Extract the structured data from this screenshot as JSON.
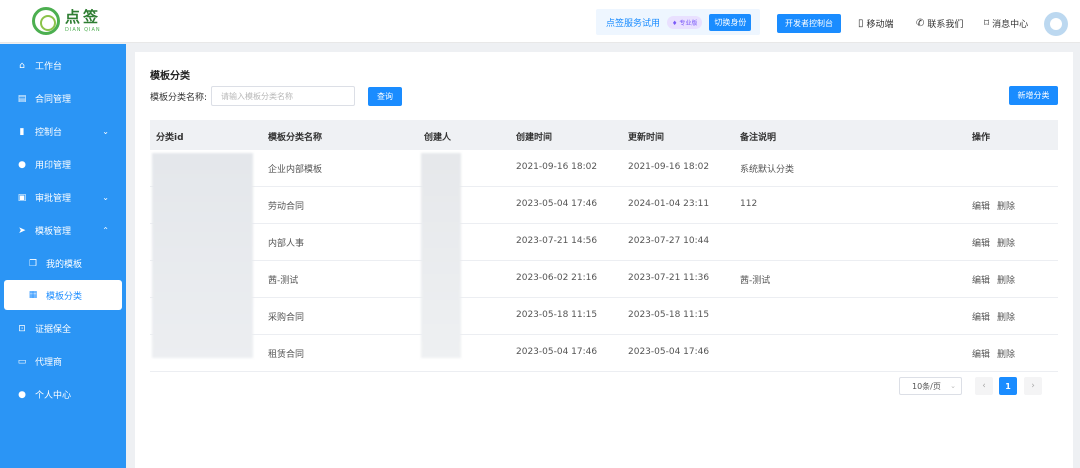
{
  "brand": {
    "name_cn": "点签",
    "name_en": "DIAN QIAN"
  },
  "header": {
    "trial_text": "点签服务试用",
    "pro_badge": "专业版",
    "switch_identity": "切换身份",
    "dev_console": "开发者控制台",
    "mobile": "移动端",
    "contact": "联系我们",
    "messages": "消息中心"
  },
  "sidebar": {
    "items": [
      {
        "label": "工作台",
        "icon": "home-icon"
      },
      {
        "label": "合同管理",
        "icon": "document-icon"
      },
      {
        "label": "控制台",
        "icon": "bar-chart-icon"
      },
      {
        "label": "用印管理",
        "icon": "user-icon"
      },
      {
        "label": "审批管理",
        "icon": "clipboard-icon"
      },
      {
        "label": "模板管理",
        "icon": "send-icon"
      },
      {
        "label": "我的模板",
        "icon": "copy-icon"
      },
      {
        "label": "模板分类",
        "icon": "grid-icon"
      },
      {
        "label": "证据保全",
        "icon": "lock-icon"
      },
      {
        "label": "代理商",
        "icon": "briefcase-icon"
      },
      {
        "label": "个人中心",
        "icon": "person-icon"
      }
    ]
  },
  "main": {
    "title": "模板分类",
    "filter_label": "模板分类名称:",
    "filter_placeholder": "请输入模板分类名称",
    "query_button": "查询",
    "add_button": "新增分类",
    "columns": [
      "分类id",
      "模板分类名称",
      "创建人",
      "创建时间",
      "更新时间",
      "备注说明",
      "操作"
    ],
    "rows": [
      {
        "name": "企业内部模板",
        "created": "2021-09-16 18:02",
        "updated": "2021-09-16 18:02",
        "note": "系统默认分类",
        "edit": "",
        "del": ""
      },
      {
        "name": "劳动合同",
        "created": "2023-05-04 17:46",
        "updated": "2024-01-04 23:11",
        "note": "112",
        "edit": "编辑",
        "del": "删除"
      },
      {
        "name": "内部人事",
        "created": "2023-07-21 14:56",
        "updated": "2023-07-27 10:44",
        "note": "",
        "edit": "编辑",
        "del": "删除"
      },
      {
        "name": "茜-测试",
        "created": "2023-06-02 21:16",
        "updated": "2023-07-21 11:36",
        "note": "茜-测试",
        "edit": "编辑",
        "del": "删除"
      },
      {
        "name": "采购合同",
        "created": "2023-05-18 11:15",
        "updated": "2023-05-18 11:15",
        "note": "",
        "edit": "编辑",
        "del": "删除"
      },
      {
        "name": "租赁合同",
        "created": "2023-05-04 17:46",
        "updated": "2023-05-04 17:46",
        "note": "",
        "edit": "编辑",
        "del": "删除"
      }
    ]
  },
  "pagination": {
    "page_size": "10条/页",
    "current_page": "1",
    "prev": "‹",
    "next": "›"
  },
  "colors": {
    "accent": "#1a8cff",
    "sidebar": "#2b95f5"
  }
}
